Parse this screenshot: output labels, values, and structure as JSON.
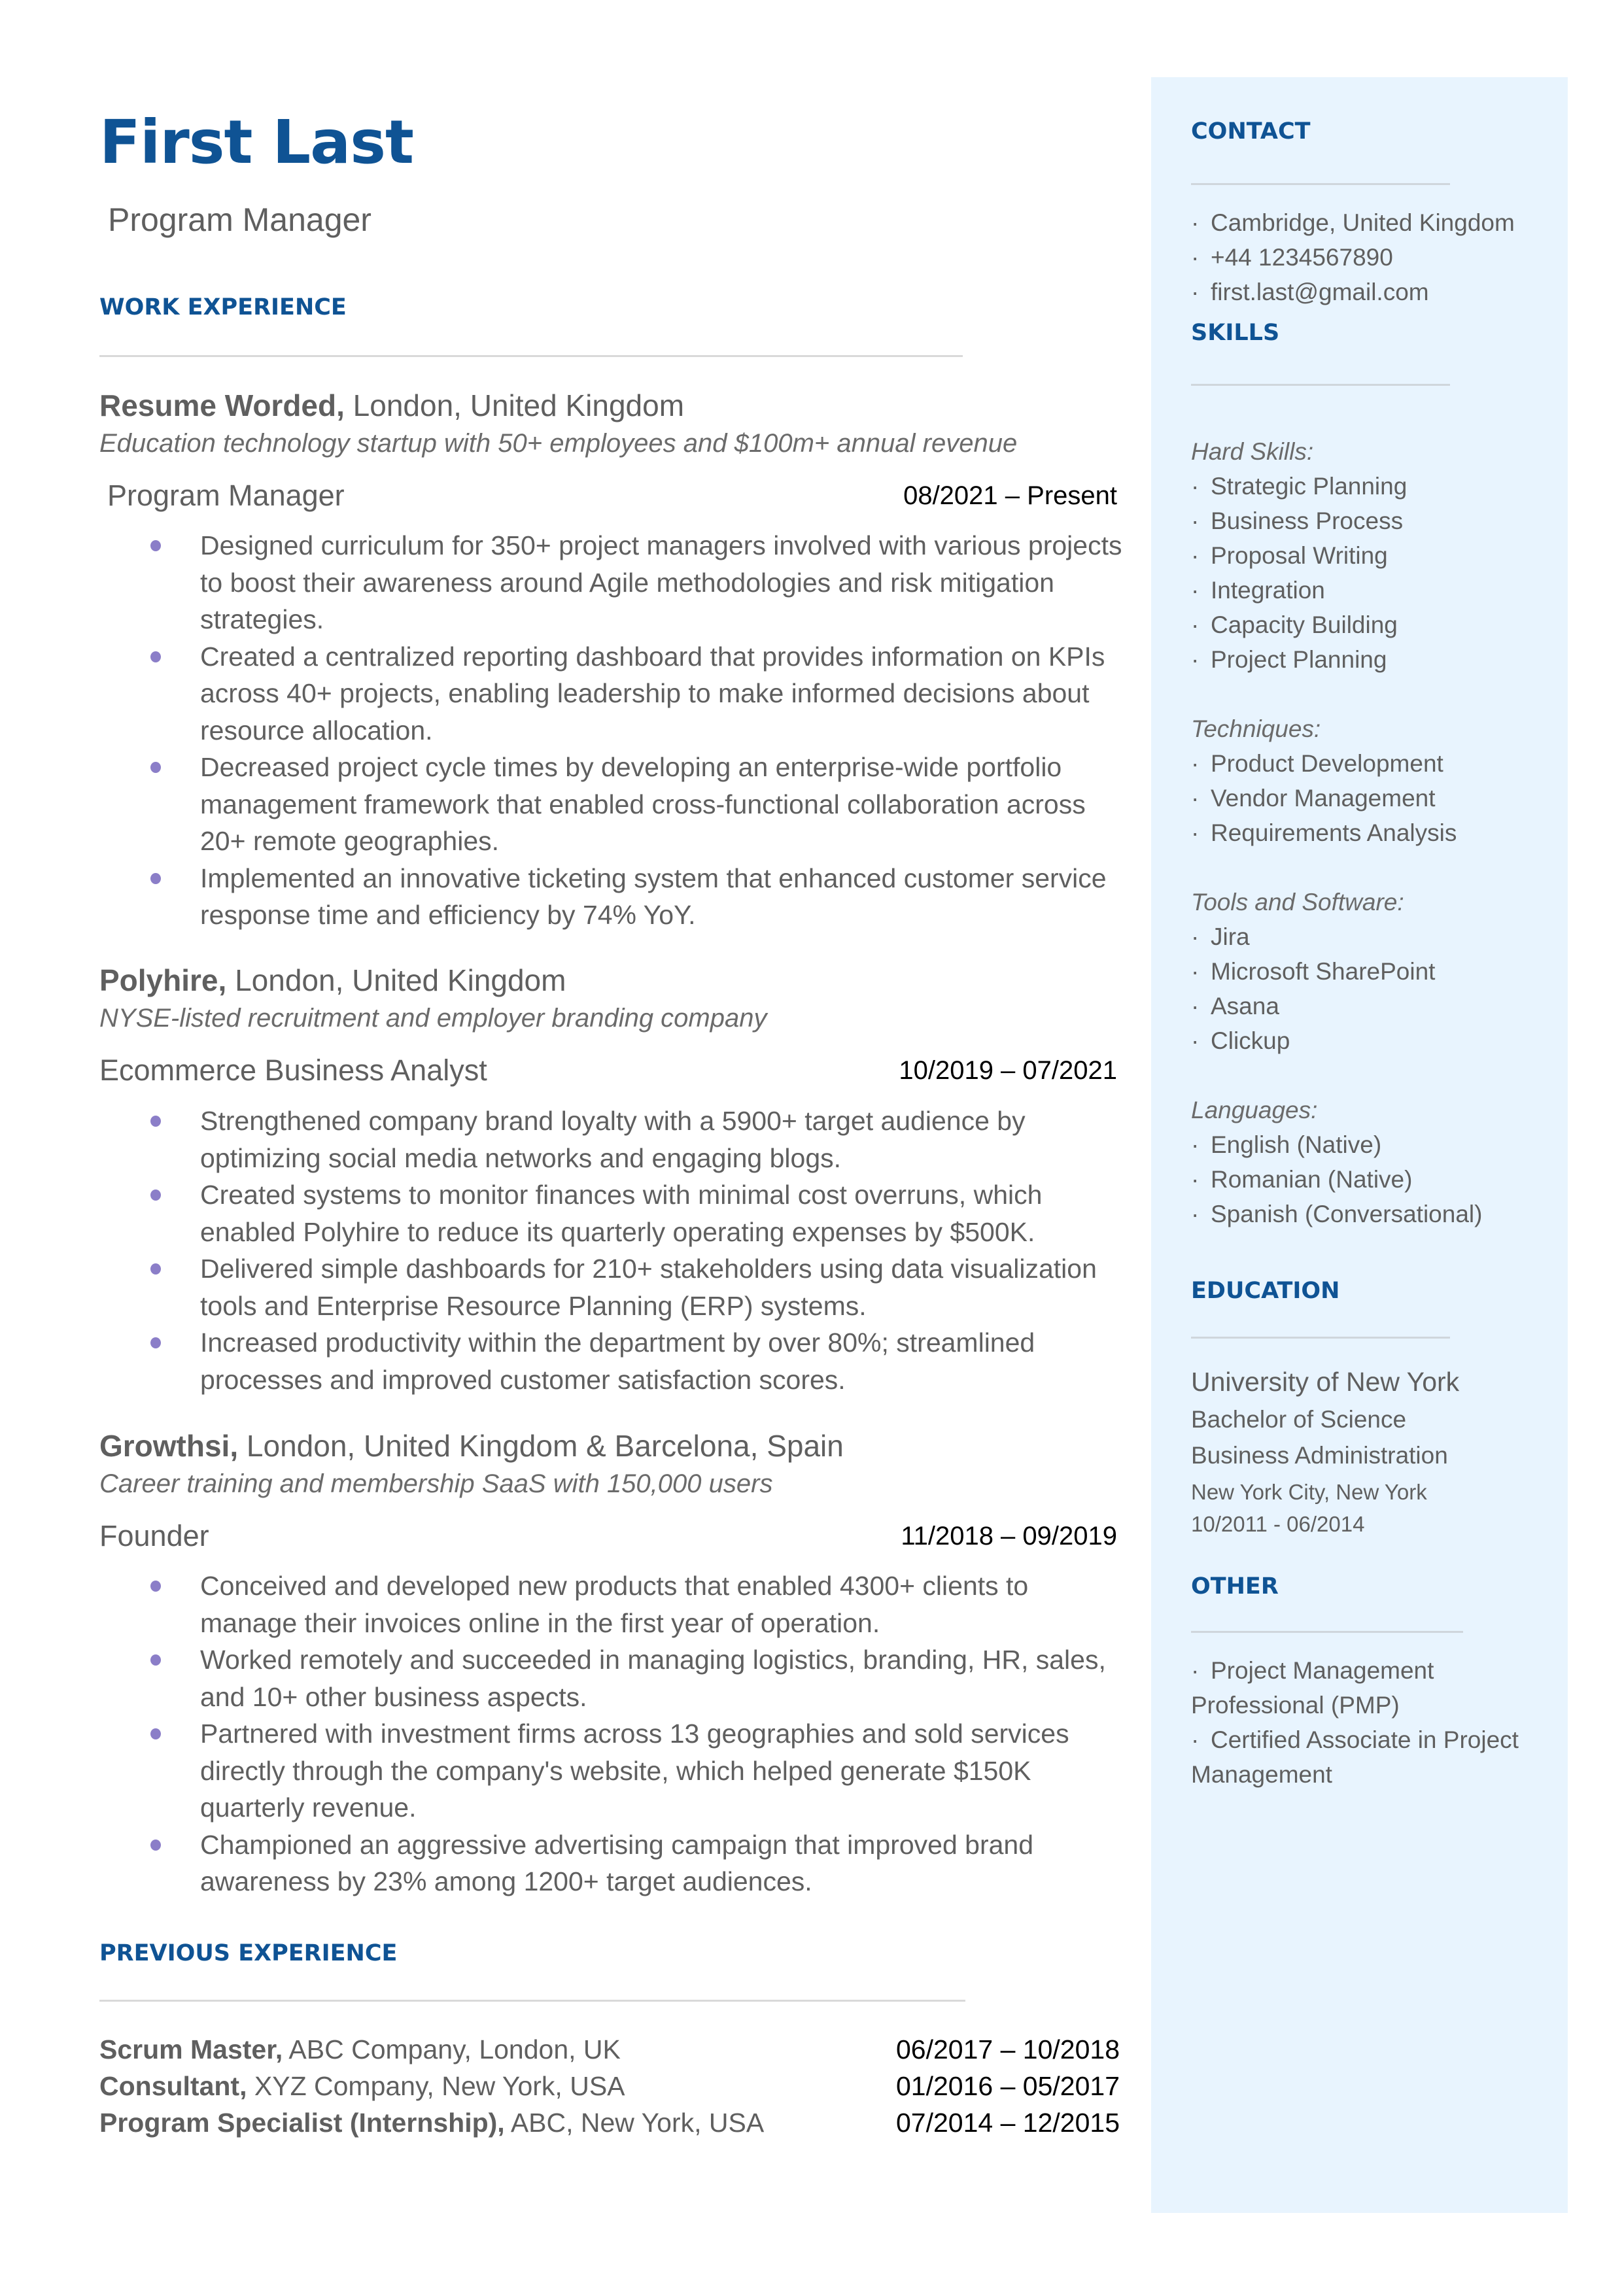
{
  "header": {
    "name": "First Last",
    "title": "Program Manager"
  },
  "colors": {
    "accent": "#0F5394",
    "bullet": "#8B7EC8",
    "sidebar_bg": "#E8F4FE",
    "text": "#5F5F5F"
  },
  "work_experience": {
    "heading": "WORK EXPERIENCE",
    "jobs": [
      {
        "company": "Resume Worded,",
        "location": " London, United Kingdom",
        "description": "Education technology startup with 50+ employees and $100m+ annual revenue",
        "role": "Program Manager",
        "dates": "08/2021 – Present",
        "bullets": [
          "Designed curriculum for 350+ project managers involved with various projects to boost their awareness around Agile methodologies and risk mitigation strategies.",
          "Created a centralized reporting dashboard that provides information on KPIs across 40+ projects, enabling leadership to make informed decisions about resource allocation.",
          "Decreased project cycle times by developing an enterprise-wide portfolio management framework that enabled cross-functional collaboration across 20+ remote geographies.",
          "Implemented an innovative ticketing system that enhanced customer service response time and efficiency by 74% YoY."
        ]
      },
      {
        "company": "Polyhire,",
        "location": " London, United Kingdom",
        "description": "NYSE-listed recruitment and employer branding company",
        "role": "Ecommerce Business Analyst",
        "dates": "10/2019 – 07/2021",
        "bullets": [
          "Strengthened company brand loyalty with a 5900+ target audience by optimizing social media networks and engaging blogs.",
          "Created systems to monitor finances with minimal cost overruns, which enabled Polyhire to reduce its quarterly operating expenses by $500K.",
          "Delivered simple dashboards for 210+ stakeholders using data visualization tools and Enterprise Resource Planning (ERP) systems.",
          "Increased productivity within the department by over 80%; streamlined processes and improved customer satisfaction scores."
        ]
      },
      {
        "company": "Growthsi,",
        "location": " London, United Kingdom & Barcelona, Spain",
        "description": "Career training and membership SaaS with 150,000 users",
        "role": "Founder",
        "dates": "11/2018 – 09/2019",
        "bullets": [
          "Conceived and developed new products that enabled 4300+ clients to manage their invoices online in the first year of operation.",
          "Worked remotely and succeeded in managing logistics, branding, HR, sales, and 10+ other business aspects.",
          "Partnered with investment firms across 13 geographies and sold services directly through the company's website, which helped generate $150K quarterly revenue.",
          "Championed an aggressive advertising campaign that improved brand awareness by 23% among 1200+ target audiences."
        ]
      }
    ]
  },
  "previous_experience": {
    "heading": "PREVIOUS EXPERIENCE",
    "items": [
      {
        "role": "Scrum Master,",
        "org": " ABC Company, London, UK",
        "dates": "06/2017 – 10/2018"
      },
      {
        "role": "Consultant,",
        "org": " XYZ Company, New York, USA",
        "dates": "01/2016 – 05/2017"
      },
      {
        "role": "Program Specialist (Internship),",
        "org": " ABC, New York, USA",
        "dates": "07/2014 – 12/2015"
      }
    ]
  },
  "sidebar": {
    "contact": {
      "heading": "CONTACT",
      "items": [
        "Cambridge, United Kingdom",
        "+44 1234567890",
        "first.last@gmail.com"
      ]
    },
    "skills": {
      "heading": "SKILLS",
      "groups": [
        {
          "label": "Hard Skills:",
          "items": [
            "Strategic Planning",
            "Business Process",
            "Proposal Writing",
            "Integration",
            "Capacity Building",
            "Project Planning"
          ]
        },
        {
          "label": "Techniques:",
          "items": [
            "Product Development",
            "Vendor Management",
            "Requirements Analysis"
          ]
        },
        {
          "label": "Tools and Software:",
          "items": [
            "Jira",
            "Microsoft SharePoint",
            "Asana",
            "Clickup"
          ]
        },
        {
          "label": "Languages:",
          "items": [
            "English (Native)",
            "Romanian (Native)",
            "Spanish (Conversational)"
          ]
        }
      ]
    },
    "education": {
      "heading": "EDUCATION",
      "school": "University of New York",
      "degree": "Bachelor of Science",
      "field": "Business Administration",
      "location": "New York City, New York",
      "dates": "10/2011 - 06/2014"
    },
    "other": {
      "heading": "OTHER",
      "items": [
        "Project Management Professional (PMP)",
        "Certified Associate in Project Management"
      ]
    }
  }
}
